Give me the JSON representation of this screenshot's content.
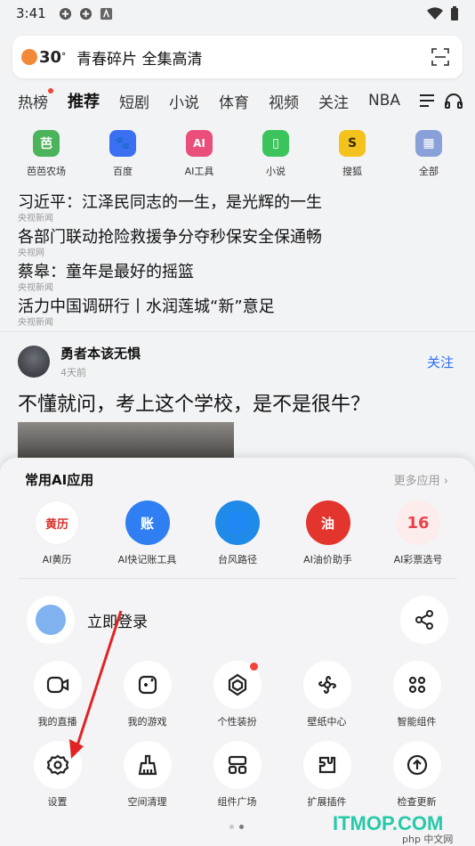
{
  "status": {
    "time": "3:41"
  },
  "search": {
    "temperature": "30",
    "degree": "°",
    "query": "青春碎片 全集高清"
  },
  "tabs": [
    "热榜",
    "推荐",
    "短剧",
    "小说",
    "体育",
    "视频",
    "关注",
    "NBA"
  ],
  "quick_apps": [
    {
      "label": "芭芭农场",
      "icon": "farm-icon",
      "color": "#4bb35a",
      "glyph": "芭"
    },
    {
      "label": "百度",
      "icon": "paw-icon",
      "color": "#3b6ff2",
      "glyph": "🐾"
    },
    {
      "label": "AI工具",
      "icon": "ai-tools-icon",
      "color": "#e94f7a",
      "glyph": "AI"
    },
    {
      "label": "小说",
      "icon": "book-icon",
      "color": "#3cc45c",
      "glyph": "▯"
    },
    {
      "label": "搜狐",
      "icon": "sohu-icon",
      "color": "#f4c21c",
      "glyph": "S"
    },
    {
      "label": "全部",
      "icon": "all-apps-icon",
      "color": "#8aa0d8",
      "glyph": "▦"
    }
  ],
  "news": [
    {
      "title": "习近平：江泽民同志的一生，是光辉的一生",
      "source": "央视新闻"
    },
    {
      "title": "各部门联动抢险救援争分夺秒保安全保通畅",
      "source": "央视网"
    },
    {
      "title": "蔡皋：童年是最好的摇篮",
      "source": "央视新闻"
    },
    {
      "title": "活力中国调研行丨水润莲城“新”意足",
      "source": "央视新闻"
    }
  ],
  "feed": {
    "author": "勇者本该无惧",
    "time": "4天前",
    "follow": "关注",
    "title": "不懂就问，考上这个学校，是不是很牛？"
  },
  "sheet": {
    "title": "常用AI应用",
    "more": "更多应用 ›",
    "ai_apps": [
      {
        "label": "AI黄历",
        "icon": "almanac-icon",
        "color": "#e23a3a",
        "glyph": "黄历"
      },
      {
        "label": "AI快记账工具",
        "icon": "ledger-icon",
        "color": "#2f7ff2",
        "glyph": "账"
      },
      {
        "label": "台风路径",
        "icon": "typhoon-icon",
        "color": "#1f8ae8",
        "glyph": "🌀"
      },
      {
        "label": "AI油价助手",
        "icon": "fuel-icon",
        "color": "#e3342d",
        "glyph": "油"
      },
      {
        "label": "AI彩票选号",
        "icon": "lottery-icon",
        "color": "#e8424a",
        "glyph": "16"
      }
    ],
    "login": "立即登录",
    "grid": [
      {
        "label": "我的直播",
        "icon": "live-camera-icon",
        "glyph": "▶"
      },
      {
        "label": "我的游戏",
        "icon": "game-icon",
        "glyph": "✚"
      },
      {
        "label": "个性装扮",
        "icon": "theme-icon",
        "glyph": "◈",
        "dot": true
      },
      {
        "label": "壁纸中心",
        "icon": "wallpaper-icon",
        "glyph": "✿"
      },
      {
        "label": "智能组件",
        "icon": "widgets-icon",
        "glyph": "⌘"
      },
      {
        "label": "设置",
        "icon": "settings-gear-icon",
        "glyph": "⚙"
      },
      {
        "label": "空间清理",
        "icon": "broom-icon",
        "glyph": "⌂"
      },
      {
        "label": "组件广场",
        "icon": "layout-icon",
        "glyph": "▤"
      },
      {
        "label": "扩展插件",
        "icon": "plugin-icon",
        "glyph": "✎"
      },
      {
        "label": "检查更新",
        "icon": "update-icon",
        "glyph": "↑"
      }
    ]
  },
  "watermark": {
    "main": "ITMOP.COM",
    "sub": "php 中文网"
  },
  "colors": {
    "accent": "#2a6df5",
    "red": "#f04436",
    "annotation": "#e02424"
  }
}
